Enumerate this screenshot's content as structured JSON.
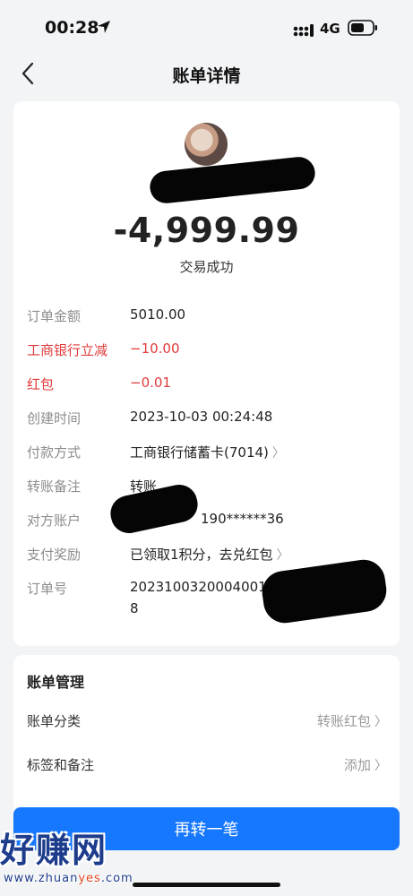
{
  "status_bar": {
    "time": "00:28",
    "network": "4G"
  },
  "nav": {
    "title": "账单详情"
  },
  "summary": {
    "amount": "-4,999.99",
    "status": "交易成功"
  },
  "details": [
    {
      "label": "订单金额",
      "value": "5010.00"
    },
    {
      "label": "工商银行立减",
      "value": "−10.00"
    },
    {
      "label": "红包",
      "value": "−0.01"
    },
    {
      "label": "创建时间",
      "value": "2023-10-03 00:24:48"
    },
    {
      "label": "付款方式",
      "value": "工商银行储蓄卡(7014)"
    },
    {
      "label": "转账备注",
      "value": "转账"
    },
    {
      "label": "对方账户",
      "value": "190******36"
    },
    {
      "label": "支付奖励",
      "value": "已领取1积分，去兑红包"
    },
    {
      "label": "订单号",
      "value": "20231003200040011",
      "value_line2": "8"
    }
  ],
  "manage": {
    "title": "账单管理",
    "items": [
      {
        "label": "账单分类",
        "value": "转账红包"
      },
      {
        "label": "标签和备注",
        "value": "添加"
      }
    ]
  },
  "actions": {
    "transfer_again": "再转一笔"
  },
  "watermark": {
    "text": "好赚网",
    "url_prefix": "www.zhuan",
    "url_highlight": "yes",
    "url_suffix": ".com"
  },
  "colors": {
    "primary": "#1677ff",
    "discount_red": "#e03b3b",
    "label_gray": "#8d8d8d",
    "background": "#f3f4f6"
  }
}
